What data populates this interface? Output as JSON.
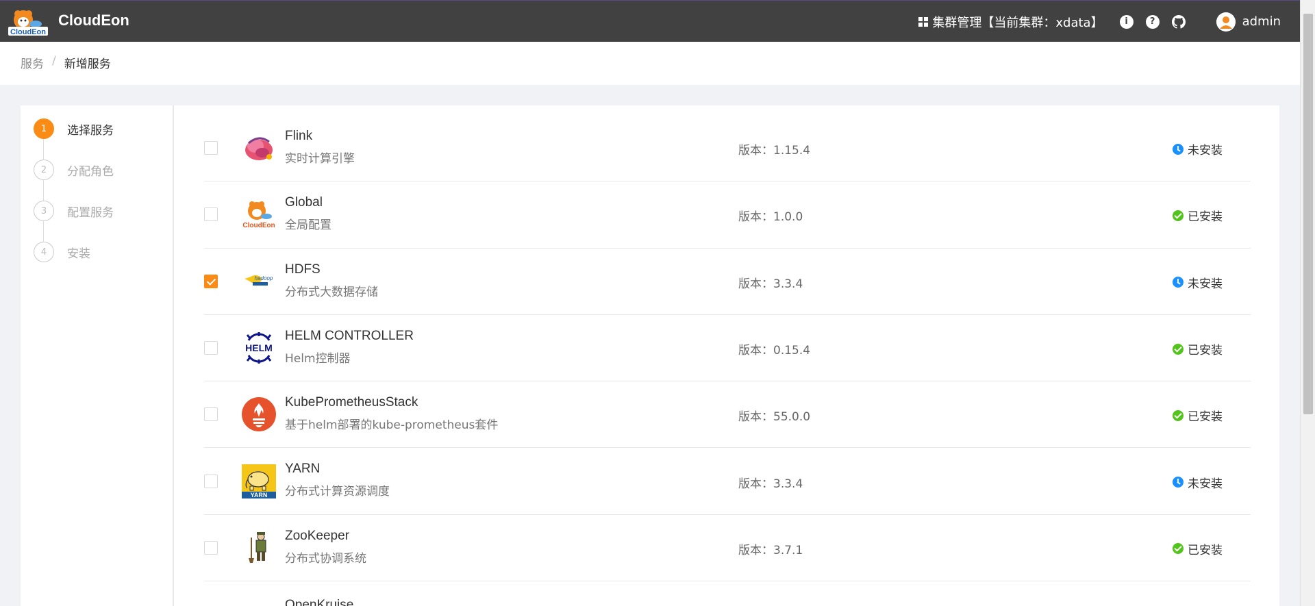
{
  "header": {
    "brand": "CloudEon",
    "logo_text": "CloudEon",
    "cluster_label": "集群管理【当前集群：xdata】",
    "user": "admin",
    "info_glyph": "i",
    "help_glyph": "?"
  },
  "breadcrumb": {
    "parent": "服务",
    "separator": "/",
    "current": "新增服务"
  },
  "steps": [
    {
      "num": "1",
      "label": "选择服务",
      "active": true
    },
    {
      "num": "2",
      "label": "分配角色",
      "active": false
    },
    {
      "num": "3",
      "label": "配置服务",
      "active": false
    },
    {
      "num": "4",
      "label": "安装",
      "active": false
    }
  ],
  "services": [
    {
      "name": "Flink",
      "desc": "实时计算引擎",
      "version": "版本：1.15.4",
      "status": "未安装",
      "checked": false,
      "installed": false,
      "icon": "flink-icon"
    },
    {
      "name": "Global",
      "desc": "全局配置",
      "version": "版本：1.0.0",
      "status": "已安装",
      "checked": false,
      "installed": true,
      "icon": "cloudeon-icon"
    },
    {
      "name": "HDFS",
      "desc": "分布式大数据存储",
      "version": "版本：3.3.4",
      "status": "未安装",
      "checked": true,
      "installed": false,
      "icon": "hadoop-icon"
    },
    {
      "name": "HELM CONTROLLER",
      "desc": "Helm控制器",
      "version": "版本：0.15.4",
      "status": "已安装",
      "checked": false,
      "installed": true,
      "icon": "helm-icon"
    },
    {
      "name": "KubePrometheusStack",
      "desc": "基于helm部署的kube-prometheus套件",
      "version": "版本：55.0.0",
      "status": "已安装",
      "checked": false,
      "installed": true,
      "icon": "prometheus-icon"
    },
    {
      "name": "YARN",
      "desc": "分布式计算资源调度",
      "version": "版本：3.3.4",
      "status": "未安装",
      "checked": false,
      "installed": false,
      "icon": "yarn-icon"
    },
    {
      "name": "ZooKeeper",
      "desc": "分布式协调系统",
      "version": "版本：3.7.1",
      "status": "已安装",
      "checked": false,
      "installed": true,
      "icon": "zookeeper-icon"
    },
    {
      "name": "OpenKruise",
      "desc": "",
      "version": "",
      "status": "",
      "checked": false,
      "installed": false,
      "icon": "openkruise-icon"
    }
  ],
  "colors": {
    "header_bg": "#414141",
    "accent": "#fa8c16",
    "installed": "#52c41a",
    "not_installed": "#1890ff"
  }
}
